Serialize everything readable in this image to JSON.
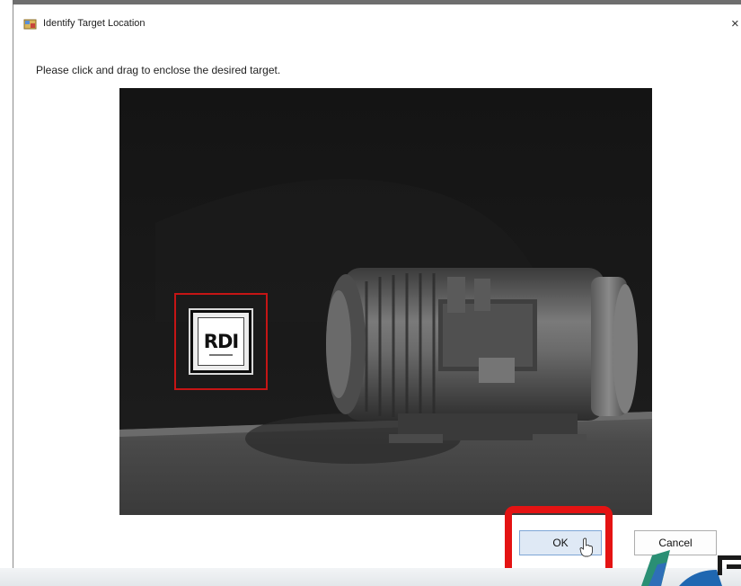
{
  "window": {
    "title": "Identify Target Location",
    "close_glyph": "×",
    "icon": "app-window-icon"
  },
  "instruction": "Please click and drag to enclose the desired target.",
  "camera_view": {
    "marker_text": "RDI",
    "selection_color": "#c51515"
  },
  "buttons": {
    "ok_label": "OK",
    "cancel_label": "Cancel"
  },
  "annotation": {
    "highlight_color": "#e41313",
    "target": "ok-button"
  },
  "cursor": {
    "icon": "hand-pointer-icon"
  }
}
